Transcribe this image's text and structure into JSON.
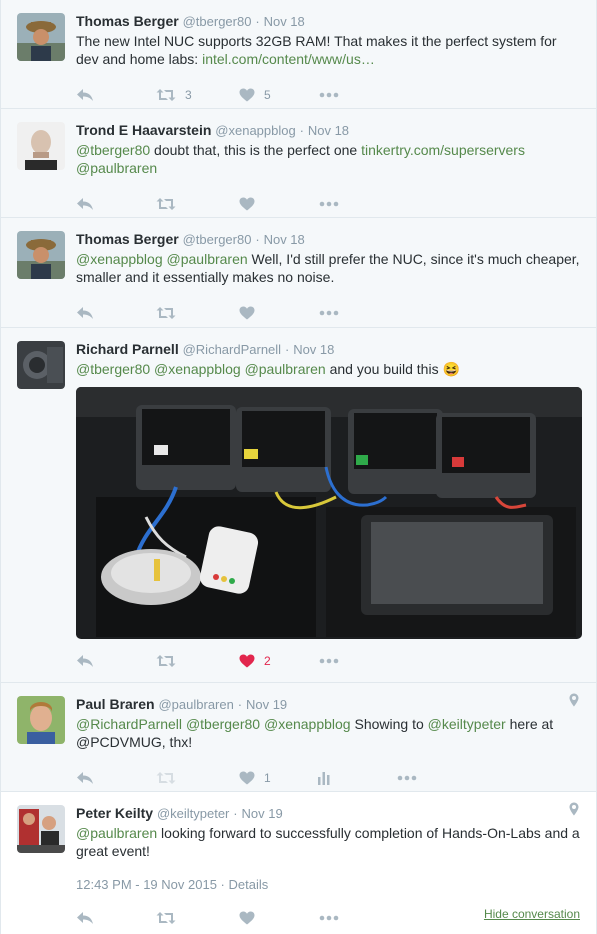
{
  "tweets": [
    {
      "name": "Thomas Berger",
      "handle": "@tberger80",
      "sep": "·",
      "date": "Nov 18",
      "text": [
        {
          "t": "The new Intel NUC supports 32GB RAM! That makes it the perfect system for dev and home labs: ",
          "k": "plain"
        },
        {
          "t": "intel.com/content/www/us…",
          "k": "link"
        }
      ],
      "retweets": "3",
      "likes": "5"
    },
    {
      "name": "Trond E Haavarstein",
      "handle": "@xenappblog",
      "sep": "·",
      "date": "Nov 18",
      "text": [
        {
          "t": "@tberger80",
          "k": "mention"
        },
        {
          "t": " doubt that, this is the perfect one ",
          "k": "plain"
        },
        {
          "t": "tinkertry.com/superservers",
          "k": "link"
        },
        {
          "t": " ",
          "k": "plain"
        },
        {
          "t": "@paulbraren",
          "k": "mention"
        }
      ],
      "retweets": "",
      "likes": ""
    },
    {
      "name": "Thomas Berger",
      "handle": "@tberger80",
      "sep": "·",
      "date": "Nov 18",
      "text": [
        {
          "t": "@xenappblog",
          "k": "mention"
        },
        {
          "t": " ",
          "k": "plain"
        },
        {
          "t": "@paulbraren",
          "k": "mention"
        },
        {
          "t": " Well, I'd still prefer the NUC, since it's much cheaper, smaller and it essentially makes no noise.",
          "k": "plain"
        }
      ],
      "retweets": "",
      "likes": ""
    },
    {
      "name": "Richard Parnell",
      "handle": "@RichardParnell",
      "sep": "·",
      "date": "Nov 18",
      "text": [
        {
          "t": "@tberger80",
          "k": "mention"
        },
        {
          "t": " ",
          "k": "plain"
        },
        {
          "t": "@xenappblog",
          "k": "mention"
        },
        {
          "t": " ",
          "k": "plain"
        },
        {
          "t": "@paulbraren",
          "k": "mention"
        },
        {
          "t": " and you build this 😆",
          "k": "plain"
        }
      ],
      "retweets": "",
      "likes": "2"
    },
    {
      "name": "Paul Braren",
      "handle": "@paulbraren",
      "sep": "·",
      "date": "Nov 19",
      "text": [
        {
          "t": "@RichardParnell",
          "k": "mention"
        },
        {
          "t": " ",
          "k": "plain"
        },
        {
          "t": "@tberger80",
          "k": "mention"
        },
        {
          "t": " ",
          "k": "plain"
        },
        {
          "t": "@xenappblog",
          "k": "mention"
        },
        {
          "t": " Showing to ",
          "k": "plain"
        },
        {
          "t": "@keiltypeter",
          "k": "mention"
        },
        {
          "t": " here at @PCDVMUG, thx!",
          "k": "plain"
        }
      ],
      "retweets": "",
      "likes": "1"
    },
    {
      "name": "Peter Keilty",
      "handle": "@keiltypeter",
      "sep": "·",
      "date": "Nov 19",
      "text": [
        {
          "t": "@paulbraren",
          "k": "mention"
        },
        {
          "t": " looking forward to successfully completion of Hands-On-Labs and a great event!",
          "k": "plain"
        }
      ],
      "retweets": "",
      "likes": ""
    }
  ],
  "focused": {
    "timestamp": "12:43 PM - 19 Nov 2015",
    "sep": " · ",
    "details": "Details",
    "hide_conversation": "Hide conversation"
  },
  "icons": {
    "reply": "reply-icon",
    "retweet": "retweet-icon",
    "like": "heart-icon",
    "more": "more-icon",
    "analytics": "analytics-icon",
    "location": "location-pin-icon"
  },
  "colors": {
    "link": "#55894b",
    "like": "#e2264d",
    "icon": "#aab8c2"
  }
}
